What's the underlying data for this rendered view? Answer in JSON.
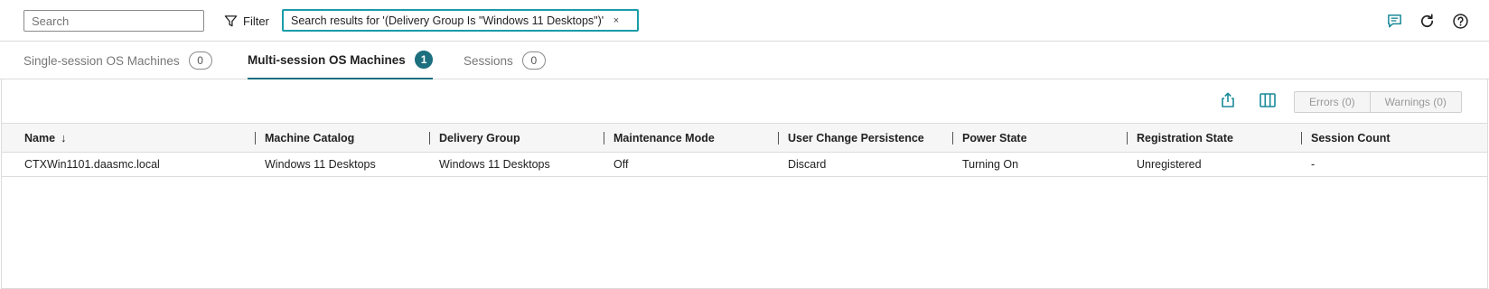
{
  "topbar": {
    "search_placeholder": "Search",
    "filter_label": "Filter",
    "filter_chip_text": "Search results for '(Delivery Group Is \"Windows 11 Desktops\")'",
    "filter_chip_close": "×",
    "icons": [
      "filter-icon",
      "chat-icon",
      "refresh-icon",
      "help-icon"
    ],
    "accent_color": "#1a9ca7"
  },
  "tabs": [
    {
      "label": "Single-session OS Machines",
      "count": "0",
      "active": false
    },
    {
      "label": "Multi-session OS Machines",
      "count": "1",
      "active": true
    },
    {
      "label": "Sessions",
      "count": "0",
      "active": false
    }
  ],
  "toolbar": {
    "icons": [
      "export-icon",
      "columns-icon"
    ],
    "errors_label": "Errors (0)",
    "warnings_label": "Warnings (0)"
  },
  "table": {
    "columns": [
      "Name",
      "Machine Catalog",
      "Delivery Group",
      "Maintenance Mode",
      "User Change Persistence",
      "Power State",
      "Registration State",
      "Session Count"
    ],
    "sort_indicator": "↓",
    "rows": [
      [
        "CTXWin1101.daasmc.local",
        "Windows 11 Desktops",
        "Windows 11 Desktops",
        "Off",
        "Discard",
        "Turning On",
        "Unregistered",
        "-"
      ]
    ]
  },
  "colors": {
    "brand_teal": "#1b6f7f",
    "icon_teal": "#1a8a9a",
    "border": "#dcdcdc"
  }
}
